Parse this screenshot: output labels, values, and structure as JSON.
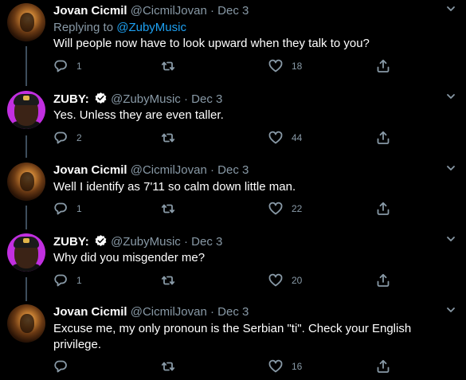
{
  "tweets": [
    {
      "author": "Jovan Cicmil",
      "handle": "@CicmilJovan",
      "sep": "·",
      "date": "Dec 3",
      "replying_prefix": "Replying to ",
      "replying_to": "@ZubyMusic",
      "text": "Will people now have to look upward when they talk to you?",
      "reply_count": "1",
      "retweet_count": "",
      "like_count": "18"
    },
    {
      "author": "ZUBY:",
      "handle": "@ZubyMusic",
      "sep": "·",
      "date": "Dec 3",
      "verified": true,
      "text": "Yes. Unless they are even taller.",
      "reply_count": "2",
      "retweet_count": "",
      "like_count": "44"
    },
    {
      "author": "Jovan Cicmil",
      "handle": "@CicmilJovan",
      "sep": "·",
      "date": "Dec 3",
      "text": "Well I identify as 7'11 so calm down little man.",
      "reply_count": "1",
      "retweet_count": "",
      "like_count": "22"
    },
    {
      "author": "ZUBY:",
      "handle": "@ZubyMusic",
      "sep": "·",
      "date": "Dec 3",
      "verified": true,
      "text": "Why did you misgender me?",
      "reply_count": "1",
      "retweet_count": "",
      "like_count": "20"
    },
    {
      "author": "Jovan Cicmil",
      "handle": "@CicmilJovan",
      "sep": "·",
      "date": "Dec 3",
      "text": "Excuse me, my only pronoun is the Serbian \"ti\". Check your English privilege.",
      "reply_count": "",
      "retweet_count": "",
      "like_count": "16"
    }
  ],
  "colors": {
    "background": "#000000",
    "secondary_text": "#8899a6",
    "link": "#1da1f2",
    "verified_badge": "#ffffff"
  }
}
